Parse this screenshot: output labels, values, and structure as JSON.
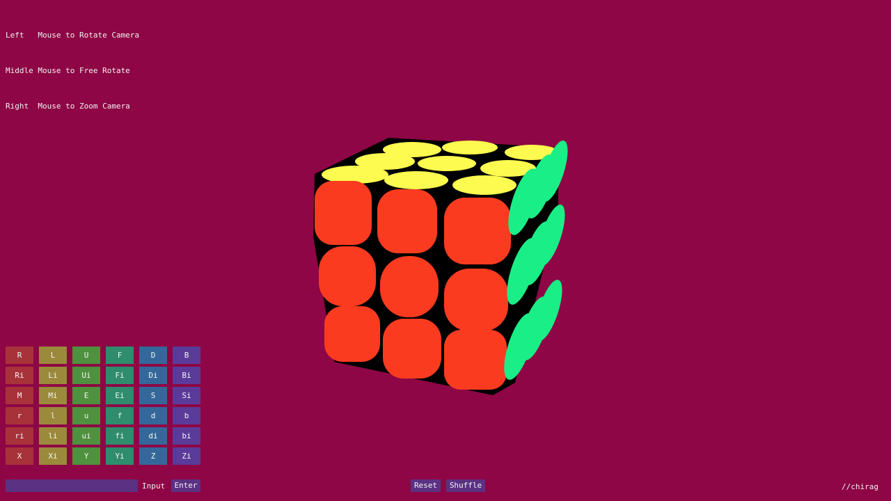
{
  "help": {
    "lines": [
      "Left   Mouse to Rotate Camera",
      "Middle Mouse to Free Rotate",
      "Right  Mouse to Zoom Camera"
    ]
  },
  "moves": {
    "rows": [
      [
        "R",
        "L",
        "U",
        "F",
        "D",
        "B"
      ],
      [
        "Ri",
        "Li",
        "Ui",
        "Fi",
        "Di",
        "Bi"
      ],
      [
        "M",
        "Mi",
        "E",
        "Ei",
        "S",
        "Si"
      ],
      [
        "r",
        "l",
        "u",
        "f",
        "d",
        "b"
      ],
      [
        "ri",
        "li",
        "ui",
        "fi",
        "di",
        "bi"
      ],
      [
        "X",
        "Xi",
        "Y",
        "Yi",
        "Z",
        "Zi"
      ]
    ]
  },
  "input": {
    "value": "",
    "label": "Input",
    "enter_label": "Enter"
  },
  "controls": {
    "reset_label": "Reset",
    "shuffle_label": "Shuffle"
  },
  "credit": "//chirag",
  "cube": {
    "top_color": "#fdfb4f",
    "front_color": "#fb3b20",
    "right_color": "#19ef86",
    "body_color": "#000000"
  },
  "colors": {
    "background": "#8e0645"
  }
}
